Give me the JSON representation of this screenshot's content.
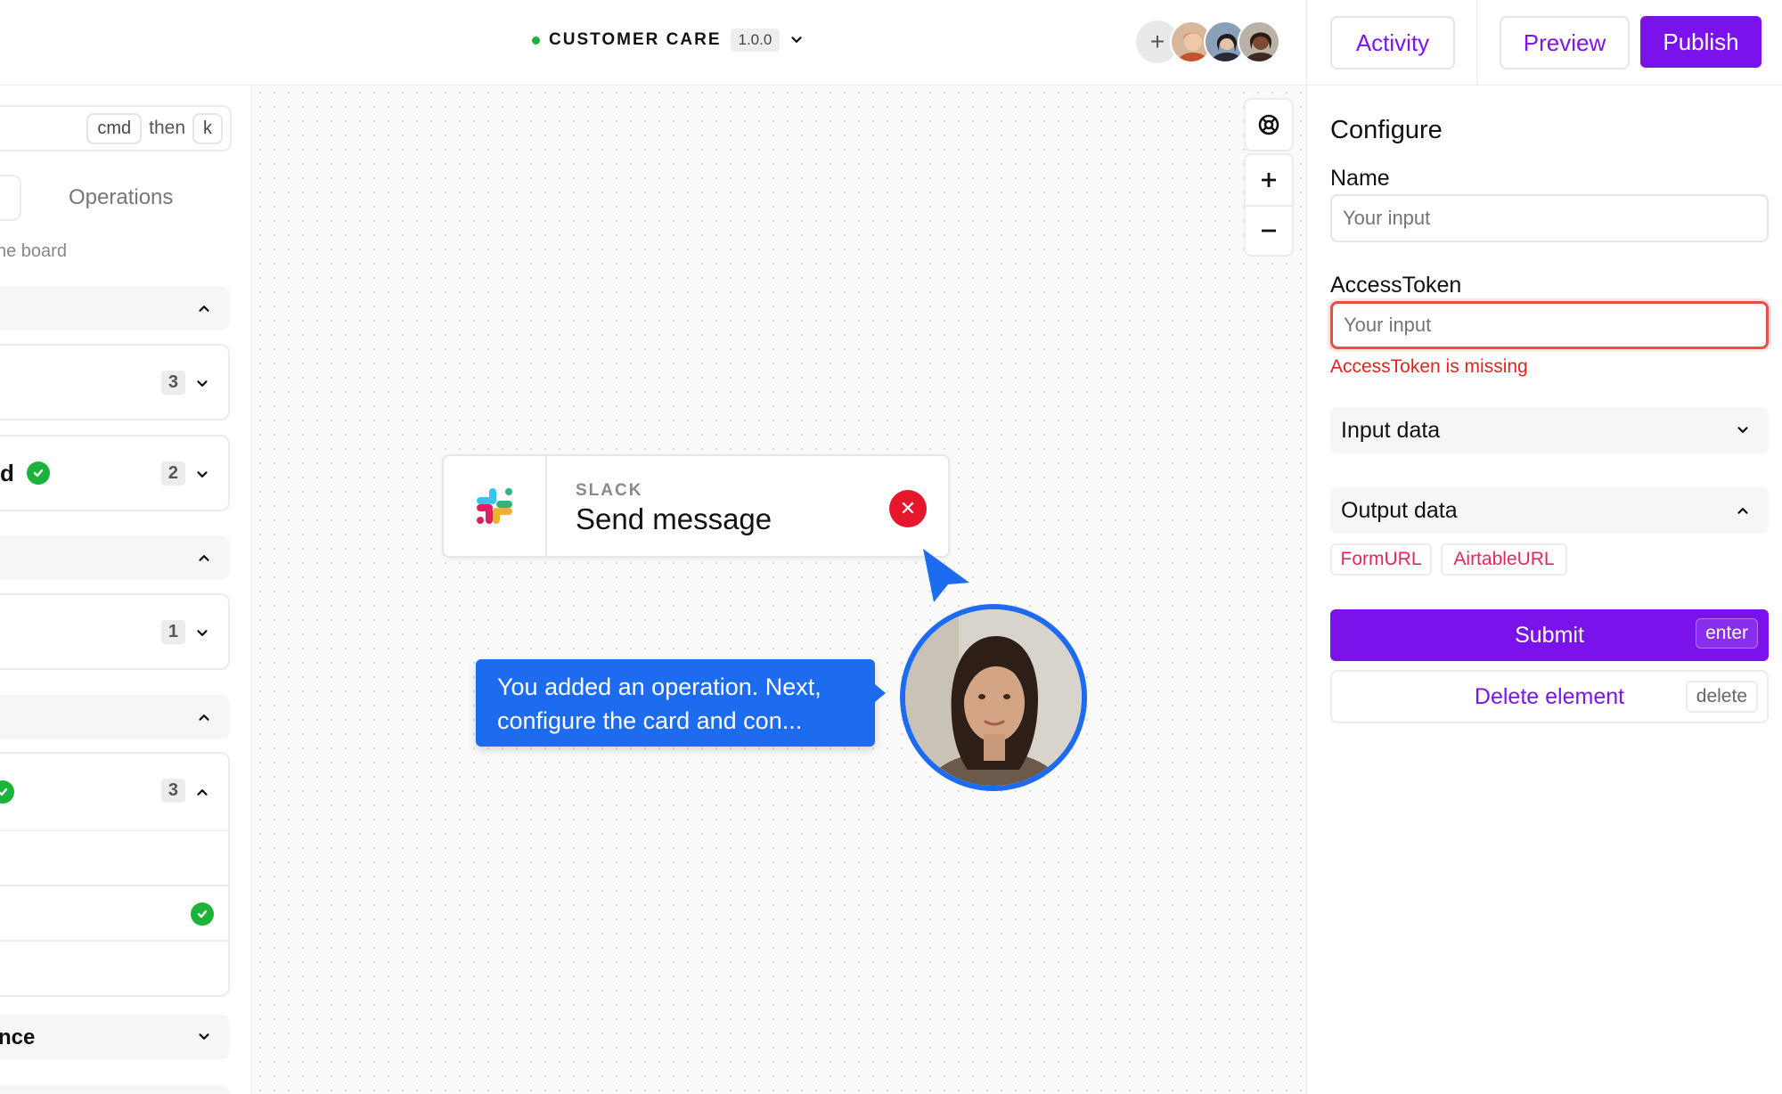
{
  "header": {
    "project_name": "CUSTOMER CARE",
    "version": "1.0.0",
    "status_color": "#1db03a"
  },
  "sidebar": {
    "shortcut": {
      "key1": "cmd",
      "then": "then",
      "key2": "k"
    },
    "tab_operations": "Operations",
    "hint": "ne board",
    "cards": [
      {
        "count": "3"
      },
      {
        "text": "d",
        "count": "2"
      },
      {
        "count": "1"
      },
      {
        "count": "3"
      }
    ],
    "last_section_label": "nce"
  },
  "canvas": {
    "node": {
      "category": "SLACK",
      "title": "Send message",
      "icon": "slack-icon",
      "error_icon": "close-icon"
    },
    "tooltip": "You added an operation. Next, configure the card and con..."
  },
  "panel": {
    "activity": "Activity",
    "preview": "Preview",
    "publish": "Publish",
    "heading": "Configure",
    "name_label": "Name",
    "name_placeholder": "Your input",
    "token_label": "AccessToken",
    "token_placeholder": "Your input",
    "token_error": "AccessToken is missing",
    "input_data": "Input data",
    "output_data": "Output data",
    "outputs": [
      "FormURL",
      "AirtableURL"
    ],
    "submit": "Submit",
    "submit_key": "enter",
    "delete": "Delete element",
    "delete_key": "delete",
    "accent": "#7a12ec",
    "error_color": "#e52222"
  }
}
